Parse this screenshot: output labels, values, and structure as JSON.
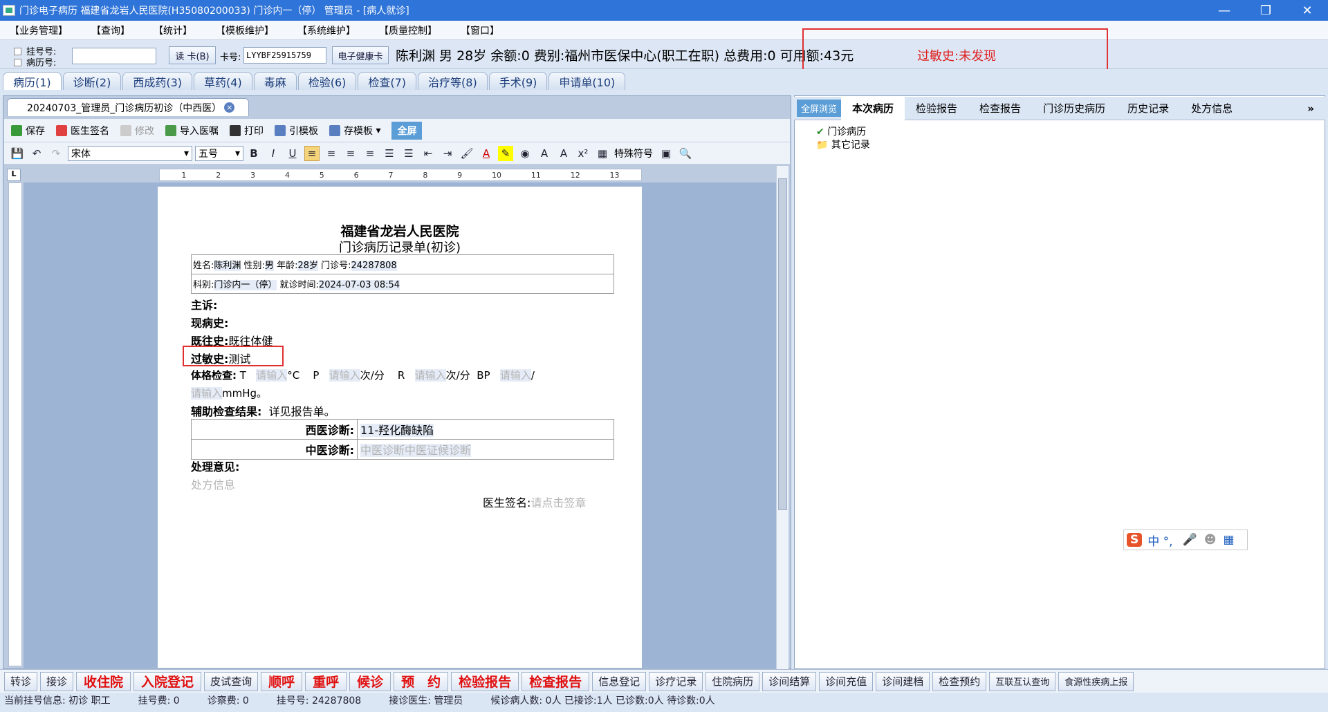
{
  "window": {
    "title": "门诊电子病历 福建省龙岩人民医院(H35080200033) 门诊内一（停） 管理员 - [病人就诊]"
  },
  "menu": [
    "【业务管理】",
    "【查询】",
    "【统计】",
    "【模板维护】",
    "【系统维护】",
    "【质量控制】",
    "【窗口】"
  ],
  "patientbar": {
    "reg_label": "挂号号:",
    "record_label": "病历号:",
    "read_card": "读 卡(B)",
    "card_label": "卡号:",
    "card_value": "LYYBF25915759",
    "ehealth_card": "电子健康卡",
    "info": "陈利渊 男 28岁 余额:0 费别:福州市医保中心(职工在职) 总费用:0 可用额:43元",
    "allergy": "过敏史:未发现"
  },
  "tabs": [
    "病历(1)",
    "诊断(2)",
    "西成药(3)",
    "草药(4)",
    "毒麻",
    "检验(6)",
    "检查(7)",
    "治疗等(8)",
    "手术(9)",
    "申请单(10)"
  ],
  "doc_tab": {
    "title": "20240703_管理员_门诊病历初诊（中西医）",
    "close": "×"
  },
  "toolbar1": {
    "save": "保存",
    "sign": "医生签名",
    "edit": "修改",
    "import": "导入医嘱",
    "print": "打印",
    "template": "引模板",
    "save_template": "存模板",
    "fullscreen": "全屏"
  },
  "toolbar2": {
    "font": "宋体",
    "size": "五号",
    "special": "特殊符号"
  },
  "ruler": [
    "1",
    "2",
    "3",
    "4",
    "5",
    "6",
    "7",
    "8",
    "9",
    "10",
    "11",
    "12",
    "13"
  ],
  "document": {
    "hospital": "福建省龙岩人民医院",
    "subtitle": "门诊病历记录单(初诊)",
    "row1": {
      "name_label": "姓名:",
      "name": "陈利渊",
      "sex_label": " 性别:",
      "sex": "男",
      "age_label": " 年龄:",
      "age": "28岁",
      "no_label": " 门诊号:",
      "no": "24287808"
    },
    "row2": {
      "dept_label": "科别:",
      "dept": "门诊内一（停）",
      "time_label": " 就诊时间:",
      "time": "2024-07-03 08:54"
    },
    "complaint": "主诉:",
    "present": "现病史:",
    "past_label": "既往史:",
    "past": "既往体健",
    "allergy_label": "过敏史:",
    "allergy": "测试",
    "exam_label": "体格检查:",
    "t": "T",
    "placeholder": "请输入",
    "unit_c": "°C",
    "p": "P",
    "unit_min": "次/分",
    "r": "R",
    "bp": "BP",
    "slash": "/",
    "mmhg": "mmHg。",
    "aux_label": "辅助检查结果:",
    "aux": "详见报告单。",
    "wm_label": "西医诊断:",
    "wm": "11-羟化酶缺陷",
    "tcm_label": "中医诊断:",
    "tcm": "中医诊断中医证候诊断",
    "treat_label": "处理意见:",
    "rx": "处方信息",
    "sign_label": "医生签名:",
    "sign": "请点击签章"
  },
  "right": {
    "tabs": [
      "全屏浏览",
      "本次病历",
      "检验报告",
      "检查报告",
      "门诊历史病历",
      "历史记录",
      "处方信息"
    ],
    "tree": [
      "门诊病历",
      "其它记录"
    ]
  },
  "ime": {
    "label": "中 °,"
  },
  "bottom": [
    {
      "label": "转诊",
      "red": false
    },
    {
      "label": "接诊",
      "red": false
    },
    {
      "label": "收住院",
      "red": true
    },
    {
      "label": "入院登记",
      "red": true
    },
    {
      "label": "皮试查询",
      "red": false
    },
    {
      "label": "顺呼",
      "red": true
    },
    {
      "label": "重呼",
      "red": true
    },
    {
      "label": "候诊",
      "red": true
    },
    {
      "label": "预　约",
      "red": true
    },
    {
      "label": "检验报告",
      "red": true
    },
    {
      "label": "检查报告",
      "red": true
    },
    {
      "label": "信息登记",
      "red": false
    },
    {
      "label": "诊疗记录",
      "red": false
    },
    {
      "label": "住院病历",
      "red": false
    },
    {
      "label": "诊间结算",
      "red": false
    },
    {
      "label": "诊间充值",
      "red": false
    },
    {
      "label": "诊间建档",
      "red": false
    },
    {
      "label": "检查预约",
      "red": false
    },
    {
      "label": "互联互认查询",
      "red": false
    },
    {
      "label": "食源性疾病上报",
      "red": false
    }
  ],
  "status": {
    "reg_info": "当前挂号信息:  初诊 职工",
    "reg_fee": "挂号费:  0",
    "diag_fee": "诊察费:  0",
    "reg_no": "挂号号:  24287808",
    "doctor": "接诊医生:  管理员",
    "counts": "候诊病人数: 0人  已接诊:1人  已诊数:0人  待诊数:0人"
  }
}
